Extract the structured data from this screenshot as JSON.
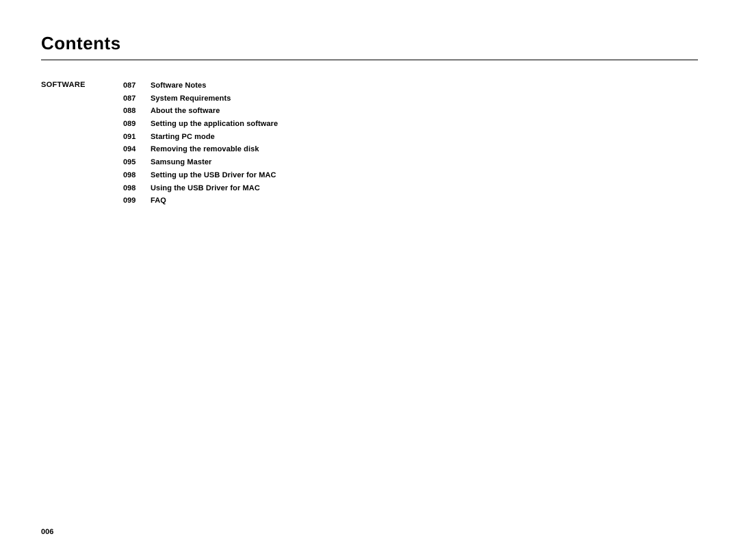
{
  "page": {
    "title": "Contents",
    "footer_page": "006"
  },
  "section": {
    "label": "SOFTWARE",
    "entries": [
      {
        "page": "087",
        "text": "Software Notes"
      },
      {
        "page": "087",
        "text": "System Requirements"
      },
      {
        "page": "088",
        "text": "About the software"
      },
      {
        "page": "089",
        "text": "Setting up the application software"
      },
      {
        "page": "091",
        "text": "Starting PC mode"
      },
      {
        "page": "094",
        "text": "Removing the removable disk"
      },
      {
        "page": "095",
        "text": "Samsung Master"
      },
      {
        "page": "098",
        "text": "Setting up the USB Driver for MAC"
      },
      {
        "page": "098",
        "text": "Using the USB Driver for MAC"
      },
      {
        "page": "099",
        "text": "FAQ"
      }
    ]
  }
}
